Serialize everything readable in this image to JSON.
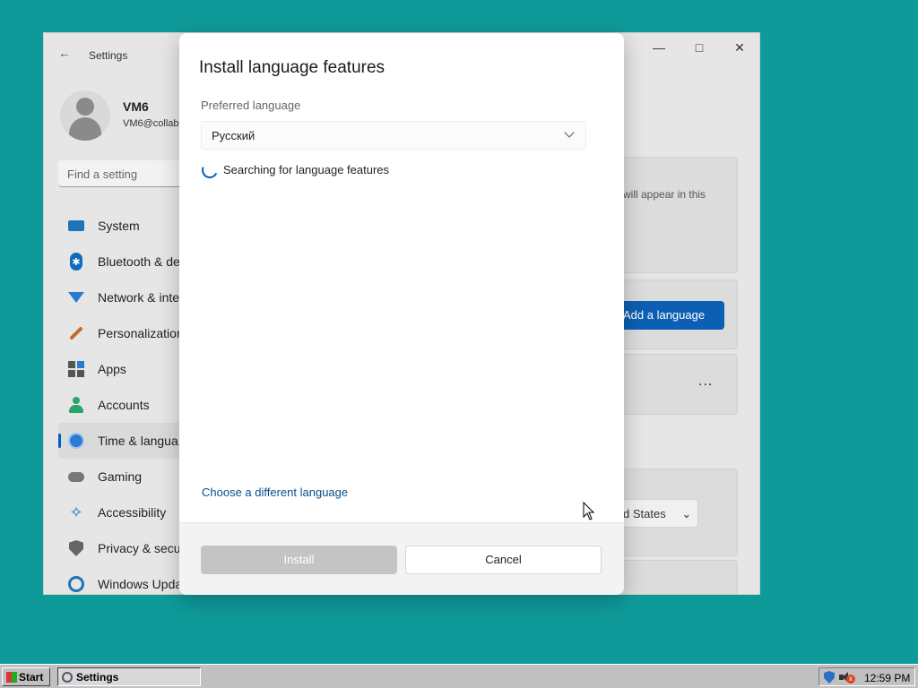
{
  "settings": {
    "window_title": "Settings",
    "profile": {
      "name": "VM6",
      "email": "VM6@collab"
    },
    "find_placeholder": "Find a setting",
    "nav": [
      {
        "label": "System",
        "icon": "monitor-icon"
      },
      {
        "label": "Bluetooth & de",
        "icon": "bluetooth-icon"
      },
      {
        "label": "Network & inte",
        "icon": "wifi-icon"
      },
      {
        "label": "Personalization",
        "icon": "brush-icon"
      },
      {
        "label": "Apps",
        "icon": "apps-icon"
      },
      {
        "label": "Accounts",
        "icon": "person-icon"
      },
      {
        "label": "Time & langua",
        "icon": "globe-clock-icon",
        "active": true
      },
      {
        "label": "Gaming",
        "icon": "gamepad-icon"
      },
      {
        "label": "Accessibility",
        "icon": "accessibility-icon"
      },
      {
        "label": "Privacy & secu",
        "icon": "shield-icon"
      },
      {
        "label": "Windows Upda",
        "icon": "update-icon"
      }
    ],
    "content": {
      "card_text": "will appear in this",
      "add_language_label": "Add a language",
      "more_label": "...",
      "region_value": "d States"
    }
  },
  "dialog": {
    "title": "Install language features",
    "preferred_language_label": "Preferred language",
    "preferred_language_value": "Русский",
    "status_text": "Searching for language features",
    "choose_link": "Choose a different language",
    "install_label": "Install",
    "cancel_label": "Cancel"
  },
  "taskbar": {
    "start_label": "Start",
    "task_label": "Settings",
    "clock": "12:59 PM"
  }
}
